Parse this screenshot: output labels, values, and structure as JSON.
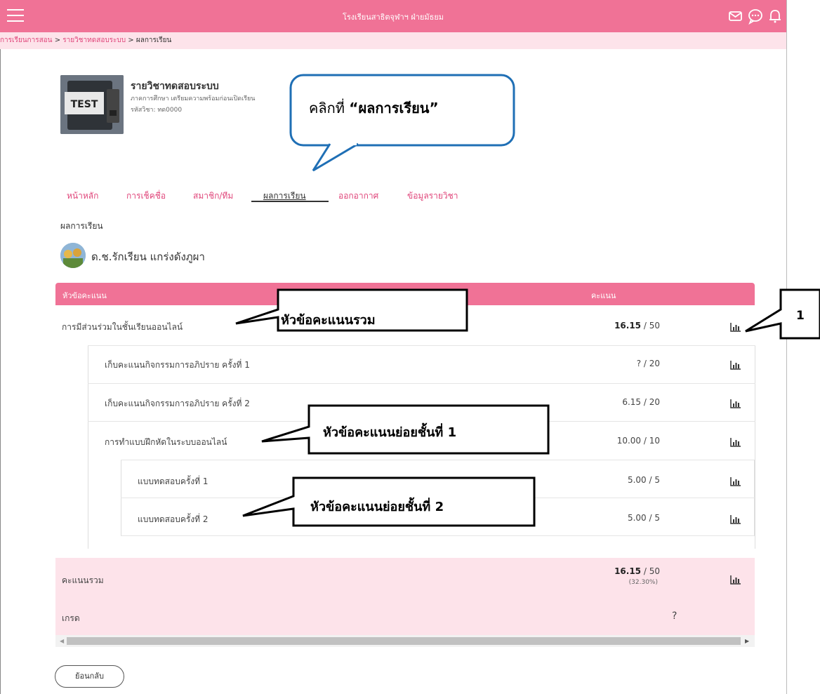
{
  "app": {
    "title": "โรงเรียนสาธิตจุฬาฯ ฝ่ายมัธยม"
  },
  "breadcrumb": {
    "part1": "การเรียนการสอน",
    "sep1": " > ",
    "part2": "รายวิชาทดสอบระบบ",
    "sep2": " > ",
    "part3": "ผลการเรียน"
  },
  "course": {
    "image_text": "TEST",
    "title": "รายวิชาทดสอบระบบ",
    "term": "ภาคการศึกษา เตรียมความพร้อมก่อนเปิดเรียน",
    "code": "รหัสวิชา: ทด0000"
  },
  "tabs": [
    {
      "label": "หน้าหลัก"
    },
    {
      "label": "การเช็คชื่อ"
    },
    {
      "label": "สมาชิก/ทีม"
    },
    {
      "label": "ผลการเรียน"
    },
    {
      "label": "ออกอากาศ"
    },
    {
      "label": "ข้อมูลรายวิชา"
    }
  ],
  "section_label": "ผลการเรียน",
  "student": {
    "name": "ด.ช.รักเรียน แกร่งดังภูผา"
  },
  "table": {
    "col_item": "หัวข้อคะแนน",
    "col_score": "คะแนน",
    "rows": [
      {
        "label": "การมีส่วนร่วมในชั้นเรียนออนไลน์",
        "score": "16.15",
        "max": " / 50"
      },
      {
        "label": "เก็บคะแนนกิจกรรมการอภิปราย ครั้งที่ 1",
        "score": "? / 20"
      },
      {
        "label": "เก็บคะแนนกิจกรรมการอภิปราย ครั้งที่ 2",
        "score": "6.15 / 20"
      },
      {
        "label": "การทำแบบฝึกหัดในระบบออนไลน์",
        "score": "10.00 / 10"
      },
      {
        "label": "แบบทดสอบครั้งที่ 1",
        "score": "5.00 / 5"
      },
      {
        "label": "แบบทดสอบครั้งที่ 2",
        "score": "5.00 / 5"
      }
    ],
    "total": {
      "label": "คะแนนรวม",
      "score": "16.15",
      "max": " / 50",
      "percent": "(32.30%)"
    },
    "grade": {
      "label": "เกรด",
      "value": "?"
    }
  },
  "back_button": "ย้อนกลับ",
  "callouts": {
    "click_prefix": "คลิกที่ ",
    "click_target": "“ผลการเรียน”",
    "total_topic": "หัวข้อคะแนนรวม",
    "sub1": "หัวข้อคะแนนย่อยชั้นที่ 1",
    "sub2": "หัวข้อคะแนนย่อยชั้นที่ 2",
    "number": "1"
  },
  "colors": {
    "brand": "#f07296",
    "light": "#fde3ea",
    "link": "#e0457a"
  },
  "icons": [
    "menu-icon",
    "mail-icon",
    "chat-icon",
    "bell-icon",
    "bar-chart-icon"
  ]
}
